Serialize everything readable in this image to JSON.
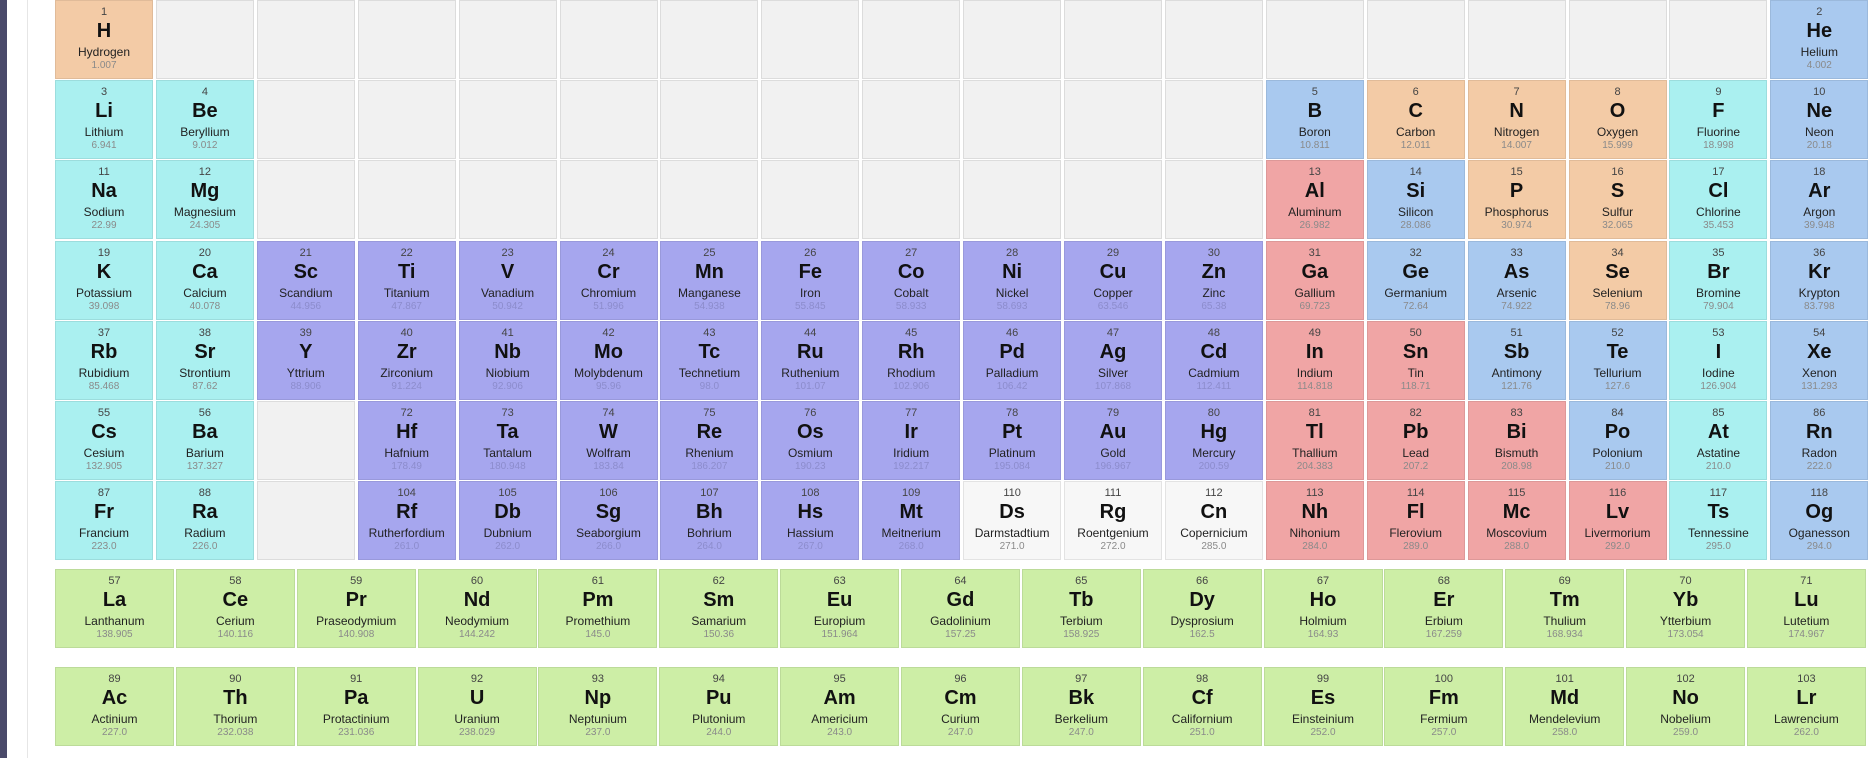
{
  "colors": {
    "alkali": "#aaf0f0",
    "metalloid": "#a9c9ef",
    "nonmetal": "#f3cba6",
    "transition": "#a6a6ee",
    "post_transition": "#f0a5a5",
    "unknown": "#f7f7f7",
    "lanthanide": "#cdeea6",
    "actinide": "#cdeea6",
    "empty": "#f1f1f1"
  },
  "elements": [
    {
      "n": "1",
      "s": "H",
      "name": "Hydrogen",
      "m": "1.007",
      "cat": "nonmetal",
      "row": 1,
      "col": 1
    },
    {
      "n": "2",
      "s": "He",
      "name": "Helium",
      "m": "4.002",
      "cat": "metalloid",
      "row": 1,
      "col": 18
    },
    {
      "n": "3",
      "s": "Li",
      "name": "Lithium",
      "m": "6.941",
      "cat": "alkali",
      "row": 2,
      "col": 1
    },
    {
      "n": "4",
      "s": "Be",
      "name": "Beryllium",
      "m": "9.012",
      "cat": "alkali",
      "row": 2,
      "col": 2
    },
    {
      "n": "5",
      "s": "B",
      "name": "Boron",
      "m": "10.811",
      "cat": "metalloid",
      "row": 2,
      "col": 13
    },
    {
      "n": "6",
      "s": "C",
      "name": "Carbon",
      "m": "12.011",
      "cat": "nonmetal",
      "row": 2,
      "col": 14
    },
    {
      "n": "7",
      "s": "N",
      "name": "Nitrogen",
      "m": "14.007",
      "cat": "nonmetal",
      "row": 2,
      "col": 15
    },
    {
      "n": "8",
      "s": "O",
      "name": "Oxygen",
      "m": "15.999",
      "cat": "nonmetal",
      "row": 2,
      "col": 16
    },
    {
      "n": "9",
      "s": "F",
      "name": "Fluorine",
      "m": "18.998",
      "cat": "alkali",
      "row": 2,
      "col": 17
    },
    {
      "n": "10",
      "s": "Ne",
      "name": "Neon",
      "m": "20.18",
      "cat": "metalloid",
      "row": 2,
      "col": 18
    },
    {
      "n": "11",
      "s": "Na",
      "name": "Sodium",
      "m": "22.99",
      "cat": "alkali",
      "row": 3,
      "col": 1
    },
    {
      "n": "12",
      "s": "Mg",
      "name": "Magnesium",
      "m": "24.305",
      "cat": "alkali",
      "row": 3,
      "col": 2
    },
    {
      "n": "13",
      "s": "Al",
      "name": "Aluminum",
      "m": "26.982",
      "cat": "post_transition",
      "row": 3,
      "col": 13
    },
    {
      "n": "14",
      "s": "Si",
      "name": "Silicon",
      "m": "28.086",
      "cat": "metalloid",
      "row": 3,
      "col": 14
    },
    {
      "n": "15",
      "s": "P",
      "name": "Phosphorus",
      "m": "30.974",
      "cat": "nonmetal",
      "row": 3,
      "col": 15
    },
    {
      "n": "16",
      "s": "S",
      "name": "Sulfur",
      "m": "32.065",
      "cat": "nonmetal",
      "row": 3,
      "col": 16
    },
    {
      "n": "17",
      "s": "Cl",
      "name": "Chlorine",
      "m": "35.453",
      "cat": "alkali",
      "row": 3,
      "col": 17
    },
    {
      "n": "18",
      "s": "Ar",
      "name": "Argon",
      "m": "39.948",
      "cat": "metalloid",
      "row": 3,
      "col": 18
    },
    {
      "n": "19",
      "s": "K",
      "name": "Potassium",
      "m": "39.098",
      "cat": "alkali",
      "row": 4,
      "col": 1
    },
    {
      "n": "20",
      "s": "Ca",
      "name": "Calcium",
      "m": "40.078",
      "cat": "alkali",
      "row": 4,
      "col": 2
    },
    {
      "n": "21",
      "s": "Sc",
      "name": "Scandium",
      "m": "44.956",
      "cat": "transition",
      "row": 4,
      "col": 3
    },
    {
      "n": "22",
      "s": "Ti",
      "name": "Titanium",
      "m": "47.867",
      "cat": "transition",
      "row": 4,
      "col": 4
    },
    {
      "n": "23",
      "s": "V",
      "name": "Vanadium",
      "m": "50.942",
      "cat": "transition",
      "row": 4,
      "col": 5
    },
    {
      "n": "24",
      "s": "Cr",
      "name": "Chromium",
      "m": "51.996",
      "cat": "transition",
      "row": 4,
      "col": 6
    },
    {
      "n": "25",
      "s": "Mn",
      "name": "Manganese",
      "m": "54.938",
      "cat": "transition",
      "row": 4,
      "col": 7
    },
    {
      "n": "26",
      "s": "Fe",
      "name": "Iron",
      "m": "55.845",
      "cat": "transition",
      "row": 4,
      "col": 8
    },
    {
      "n": "27",
      "s": "Co",
      "name": "Cobalt",
      "m": "58.933",
      "cat": "transition",
      "row": 4,
      "col": 9
    },
    {
      "n": "28",
      "s": "Ni",
      "name": "Nickel",
      "m": "58.693",
      "cat": "transition",
      "row": 4,
      "col": 10
    },
    {
      "n": "29",
      "s": "Cu",
      "name": "Copper",
      "m": "63.546",
      "cat": "transition",
      "row": 4,
      "col": 11
    },
    {
      "n": "30",
      "s": "Zn",
      "name": "Zinc",
      "m": "65.38",
      "cat": "transition",
      "row": 4,
      "col": 12
    },
    {
      "n": "31",
      "s": "Ga",
      "name": "Gallium",
      "m": "69.723",
      "cat": "post_transition",
      "row": 4,
      "col": 13
    },
    {
      "n": "32",
      "s": "Ge",
      "name": "Germanium",
      "m": "72.64",
      "cat": "metalloid",
      "row": 4,
      "col": 14
    },
    {
      "n": "33",
      "s": "As",
      "name": "Arsenic",
      "m": "74.922",
      "cat": "metalloid",
      "row": 4,
      "col": 15
    },
    {
      "n": "34",
      "s": "Se",
      "name": "Selenium",
      "m": "78.96",
      "cat": "nonmetal",
      "row": 4,
      "col": 16
    },
    {
      "n": "35",
      "s": "Br",
      "name": "Bromine",
      "m": "79.904",
      "cat": "alkali",
      "row": 4,
      "col": 17
    },
    {
      "n": "36",
      "s": "Kr",
      "name": "Krypton",
      "m": "83.798",
      "cat": "metalloid",
      "row": 4,
      "col": 18
    },
    {
      "n": "37",
      "s": "Rb",
      "name": "Rubidium",
      "m": "85.468",
      "cat": "alkali",
      "row": 5,
      "col": 1
    },
    {
      "n": "38",
      "s": "Sr",
      "name": "Strontium",
      "m": "87.62",
      "cat": "alkali",
      "row": 5,
      "col": 2
    },
    {
      "n": "39",
      "s": "Y",
      "name": "Yttrium",
      "m": "88.906",
      "cat": "transition",
      "row": 5,
      "col": 3
    },
    {
      "n": "40",
      "s": "Zr",
      "name": "Zirconium",
      "m": "91.224",
      "cat": "transition",
      "row": 5,
      "col": 4
    },
    {
      "n": "41",
      "s": "Nb",
      "name": "Niobium",
      "m": "92.906",
      "cat": "transition",
      "row": 5,
      "col": 5
    },
    {
      "n": "42",
      "s": "Mo",
      "name": "Molybdenum",
      "m": "95.96",
      "cat": "transition",
      "row": 5,
      "col": 6
    },
    {
      "n": "43",
      "s": "Tc",
      "name": "Technetium",
      "m": "98.0",
      "cat": "transition",
      "row": 5,
      "col": 7
    },
    {
      "n": "44",
      "s": "Ru",
      "name": "Ruthenium",
      "m": "101.07",
      "cat": "transition",
      "row": 5,
      "col": 8
    },
    {
      "n": "45",
      "s": "Rh",
      "name": "Rhodium",
      "m": "102.906",
      "cat": "transition",
      "row": 5,
      "col": 9
    },
    {
      "n": "46",
      "s": "Pd",
      "name": "Palladium",
      "m": "106.42",
      "cat": "transition",
      "row": 5,
      "col": 10
    },
    {
      "n": "47",
      "s": "Ag",
      "name": "Silver",
      "m": "107.868",
      "cat": "transition",
      "row": 5,
      "col": 11
    },
    {
      "n": "48",
      "s": "Cd",
      "name": "Cadmium",
      "m": "112.411",
      "cat": "transition",
      "row": 5,
      "col": 12
    },
    {
      "n": "49",
      "s": "In",
      "name": "Indium",
      "m": "114.818",
      "cat": "post_transition",
      "row": 5,
      "col": 13
    },
    {
      "n": "50",
      "s": "Sn",
      "name": "Tin",
      "m": "118.71",
      "cat": "post_transition",
      "row": 5,
      "col": 14
    },
    {
      "n": "51",
      "s": "Sb",
      "name": "Antimony",
      "m": "121.76",
      "cat": "metalloid",
      "row": 5,
      "col": 15
    },
    {
      "n": "52",
      "s": "Te",
      "name": "Tellurium",
      "m": "127.6",
      "cat": "metalloid",
      "row": 5,
      "col": 16
    },
    {
      "n": "53",
      "s": "I",
      "name": "Iodine",
      "m": "126.904",
      "cat": "alkali",
      "row": 5,
      "col": 17
    },
    {
      "n": "54",
      "s": "Xe",
      "name": "Xenon",
      "m": "131.293",
      "cat": "metalloid",
      "row": 5,
      "col": 18
    },
    {
      "n": "55",
      "s": "Cs",
      "name": "Cesium",
      "m": "132.905",
      "cat": "alkali",
      "row": 6,
      "col": 1
    },
    {
      "n": "56",
      "s": "Ba",
      "name": "Barium",
      "m": "137.327",
      "cat": "alkali",
      "row": 6,
      "col": 2
    },
    {
      "n": "72",
      "s": "Hf",
      "name": "Hafnium",
      "m": "178.49",
      "cat": "transition",
      "row": 6,
      "col": 4
    },
    {
      "n": "73",
      "s": "Ta",
      "name": "Tantalum",
      "m": "180.948",
      "cat": "transition",
      "row": 6,
      "col": 5
    },
    {
      "n": "74",
      "s": "W",
      "name": "Wolfram",
      "m": "183.84",
      "cat": "transition",
      "row": 6,
      "col": 6
    },
    {
      "n": "75",
      "s": "Re",
      "name": "Rhenium",
      "m": "186.207",
      "cat": "transition",
      "row": 6,
      "col": 7
    },
    {
      "n": "76",
      "s": "Os",
      "name": "Osmium",
      "m": "190.23",
      "cat": "transition",
      "row": 6,
      "col": 8
    },
    {
      "n": "77",
      "s": "Ir",
      "name": "Iridium",
      "m": "192.217",
      "cat": "transition",
      "row": 6,
      "col": 9
    },
    {
      "n": "78",
      "s": "Pt",
      "name": "Platinum",
      "m": "195.084",
      "cat": "transition",
      "row": 6,
      "col": 10
    },
    {
      "n": "79",
      "s": "Au",
      "name": "Gold",
      "m": "196.967",
      "cat": "transition",
      "row": 6,
      "col": 11
    },
    {
      "n": "80",
      "s": "Hg",
      "name": "Mercury",
      "m": "200.59",
      "cat": "transition",
      "row": 6,
      "col": 12
    },
    {
      "n": "81",
      "s": "Tl",
      "name": "Thallium",
      "m": "204.383",
      "cat": "post_transition",
      "row": 6,
      "col": 13
    },
    {
      "n": "82",
      "s": "Pb",
      "name": "Lead",
      "m": "207.2",
      "cat": "post_transition",
      "row": 6,
      "col": 14
    },
    {
      "n": "83",
      "s": "Bi",
      "name": "Bismuth",
      "m": "208.98",
      "cat": "post_transition",
      "row": 6,
      "col": 15
    },
    {
      "n": "84",
      "s": "Po",
      "name": "Polonium",
      "m": "210.0",
      "cat": "metalloid",
      "row": 6,
      "col": 16
    },
    {
      "n": "85",
      "s": "At",
      "name": "Astatine",
      "m": "210.0",
      "cat": "alkali",
      "row": 6,
      "col": 17
    },
    {
      "n": "86",
      "s": "Rn",
      "name": "Radon",
      "m": "222.0",
      "cat": "metalloid",
      "row": 6,
      "col": 18
    },
    {
      "n": "87",
      "s": "Fr",
      "name": "Francium",
      "m": "223.0",
      "cat": "alkali",
      "row": 7,
      "col": 1
    },
    {
      "n": "88",
      "s": "Ra",
      "name": "Radium",
      "m": "226.0",
      "cat": "alkali",
      "row": 7,
      "col": 2
    },
    {
      "n": "104",
      "s": "Rf",
      "name": "Rutherfordium",
      "m": "261.0",
      "cat": "transition",
      "row": 7,
      "col": 4
    },
    {
      "n": "105",
      "s": "Db",
      "name": "Dubnium",
      "m": "262.0",
      "cat": "transition",
      "row": 7,
      "col": 5
    },
    {
      "n": "106",
      "s": "Sg",
      "name": "Seaborgium",
      "m": "266.0",
      "cat": "transition",
      "row": 7,
      "col": 6
    },
    {
      "n": "107",
      "s": "Bh",
      "name": "Bohrium",
      "m": "264.0",
      "cat": "transition",
      "row": 7,
      "col": 7
    },
    {
      "n": "108",
      "s": "Hs",
      "name": "Hassium",
      "m": "267.0",
      "cat": "transition",
      "row": 7,
      "col": 8
    },
    {
      "n": "109",
      "s": "Mt",
      "name": "Meitnerium",
      "m": "268.0",
      "cat": "transition",
      "row": 7,
      "col": 9
    },
    {
      "n": "110",
      "s": "Ds",
      "name": "Darmstadtium",
      "m": "271.0",
      "cat": "unknown",
      "row": 7,
      "col": 10
    },
    {
      "n": "111",
      "s": "Rg",
      "name": "Roentgenium",
      "m": "272.0",
      "cat": "unknown",
      "row": 7,
      "col": 11
    },
    {
      "n": "112",
      "s": "Cn",
      "name": "Copernicium",
      "m": "285.0",
      "cat": "unknown",
      "row": 7,
      "col": 12
    },
    {
      "n": "113",
      "s": "Nh",
      "name": "Nihonium",
      "m": "284.0",
      "cat": "post_transition",
      "row": 7,
      "col": 13
    },
    {
      "n": "114",
      "s": "Fl",
      "name": "Flerovium",
      "m": "289.0",
      "cat": "post_transition",
      "row": 7,
      "col": 14
    },
    {
      "n": "115",
      "s": "Mc",
      "name": "Moscovium",
      "m": "288.0",
      "cat": "post_transition",
      "row": 7,
      "col": 15
    },
    {
      "n": "116",
      "s": "Lv",
      "name": "Livermorium",
      "m": "292.0",
      "cat": "post_transition",
      "row": 7,
      "col": 16
    },
    {
      "n": "117",
      "s": "Ts",
      "name": "Tennessine",
      "m": "295.0",
      "cat": "alkali",
      "row": 7,
      "col": 17
    },
    {
      "n": "118",
      "s": "Og",
      "name": "Oganesson",
      "m": "294.0",
      "cat": "metalloid",
      "row": 7,
      "col": 18
    }
  ],
  "empty_cells": [
    {
      "row": 1,
      "col": 2
    },
    {
      "row": 1,
      "col": 3
    },
    {
      "row": 1,
      "col": 4
    },
    {
      "row": 1,
      "col": 5
    },
    {
      "row": 1,
      "col": 6
    },
    {
      "row": 1,
      "col": 7
    },
    {
      "row": 1,
      "col": 8
    },
    {
      "row": 1,
      "col": 9
    },
    {
      "row": 1,
      "col": 10
    },
    {
      "row": 1,
      "col": 11
    },
    {
      "row": 1,
      "col": 12
    },
    {
      "row": 1,
      "col": 13
    },
    {
      "row": 1,
      "col": 14
    },
    {
      "row": 1,
      "col": 15
    },
    {
      "row": 1,
      "col": 16
    },
    {
      "row": 1,
      "col": 17
    },
    {
      "row": 2,
      "col": 3
    },
    {
      "row": 2,
      "col": 4
    },
    {
      "row": 2,
      "col": 5
    },
    {
      "row": 2,
      "col": 6
    },
    {
      "row": 2,
      "col": 7
    },
    {
      "row": 2,
      "col": 8
    },
    {
      "row": 2,
      "col": 9
    },
    {
      "row": 2,
      "col": 10
    },
    {
      "row": 2,
      "col": 11
    },
    {
      "row": 2,
      "col": 12
    },
    {
      "row": 3,
      "col": 3
    },
    {
      "row": 3,
      "col": 4
    },
    {
      "row": 3,
      "col": 5
    },
    {
      "row": 3,
      "col": 6
    },
    {
      "row": 3,
      "col": 7
    },
    {
      "row": 3,
      "col": 8
    },
    {
      "row": 3,
      "col": 9
    },
    {
      "row": 3,
      "col": 10
    },
    {
      "row": 3,
      "col": 11
    },
    {
      "row": 3,
      "col": 12
    },
    {
      "row": 6,
      "col": 3
    },
    {
      "row": 7,
      "col": 3
    }
  ],
  "lanthanides": [
    {
      "n": "57",
      "s": "La",
      "name": "Lanthanum",
      "m": "138.905"
    },
    {
      "n": "58",
      "s": "Ce",
      "name": "Cerium",
      "m": "140.116"
    },
    {
      "n": "59",
      "s": "Pr",
      "name": "Praseodymium",
      "m": "140.908"
    },
    {
      "n": "60",
      "s": "Nd",
      "name": "Neodymium",
      "m": "144.242"
    },
    {
      "n": "61",
      "s": "Pm",
      "name": "Promethium",
      "m": "145.0"
    },
    {
      "n": "62",
      "s": "Sm",
      "name": "Samarium",
      "m": "150.36"
    },
    {
      "n": "63",
      "s": "Eu",
      "name": "Europium",
      "m": "151.964"
    },
    {
      "n": "64",
      "s": "Gd",
      "name": "Gadolinium",
      "m": "157.25"
    },
    {
      "n": "65",
      "s": "Tb",
      "name": "Terbium",
      "m": "158.925"
    },
    {
      "n": "66",
      "s": "Dy",
      "name": "Dysprosium",
      "m": "162.5"
    },
    {
      "n": "67",
      "s": "Ho",
      "name": "Holmium",
      "m": "164.93"
    },
    {
      "n": "68",
      "s": "Er",
      "name": "Erbium",
      "m": "167.259"
    },
    {
      "n": "69",
      "s": "Tm",
      "name": "Thulium",
      "m": "168.934"
    },
    {
      "n": "70",
      "s": "Yb",
      "name": "Ytterbium",
      "m": "173.054"
    },
    {
      "n": "71",
      "s": "Lu",
      "name": "Lutetium",
      "m": "174.967"
    }
  ],
  "actinides": [
    {
      "n": "89",
      "s": "Ac",
      "name": "Actinium",
      "m": "227.0"
    },
    {
      "n": "90",
      "s": "Th",
      "name": "Thorium",
      "m": "232.038"
    },
    {
      "n": "91",
      "s": "Pa",
      "name": "Protactinium",
      "m": "231.036"
    },
    {
      "n": "92",
      "s": "U",
      "name": "Uranium",
      "m": "238.029"
    },
    {
      "n": "93",
      "s": "Np",
      "name": "Neptunium",
      "m": "237.0"
    },
    {
      "n": "94",
      "s": "Pu",
      "name": "Plutonium",
      "m": "244.0"
    },
    {
      "n": "95",
      "s": "Am",
      "name": "Americium",
      "m": "243.0"
    },
    {
      "n": "96",
      "s": "Cm",
      "name": "Curium",
      "m": "247.0"
    },
    {
      "n": "97",
      "s": "Bk",
      "name": "Berkelium",
      "m": "247.0"
    },
    {
      "n": "98",
      "s": "Cf",
      "name": "Californium",
      "m": "251.0"
    },
    {
      "n": "99",
      "s": "Es",
      "name": "Einsteinium",
      "m": "252.0"
    },
    {
      "n": "100",
      "s": "Fm",
      "name": "Fermium",
      "m": "257.0"
    },
    {
      "n": "101",
      "s": "Md",
      "name": "Mendelevium",
      "m": "258.0"
    },
    {
      "n": "102",
      "s": "No",
      "name": "Nobelium",
      "m": "259.0"
    },
    {
      "n": "103",
      "s": "Lr",
      "name": "Lawrencium",
      "m": "262.0"
    }
  ]
}
